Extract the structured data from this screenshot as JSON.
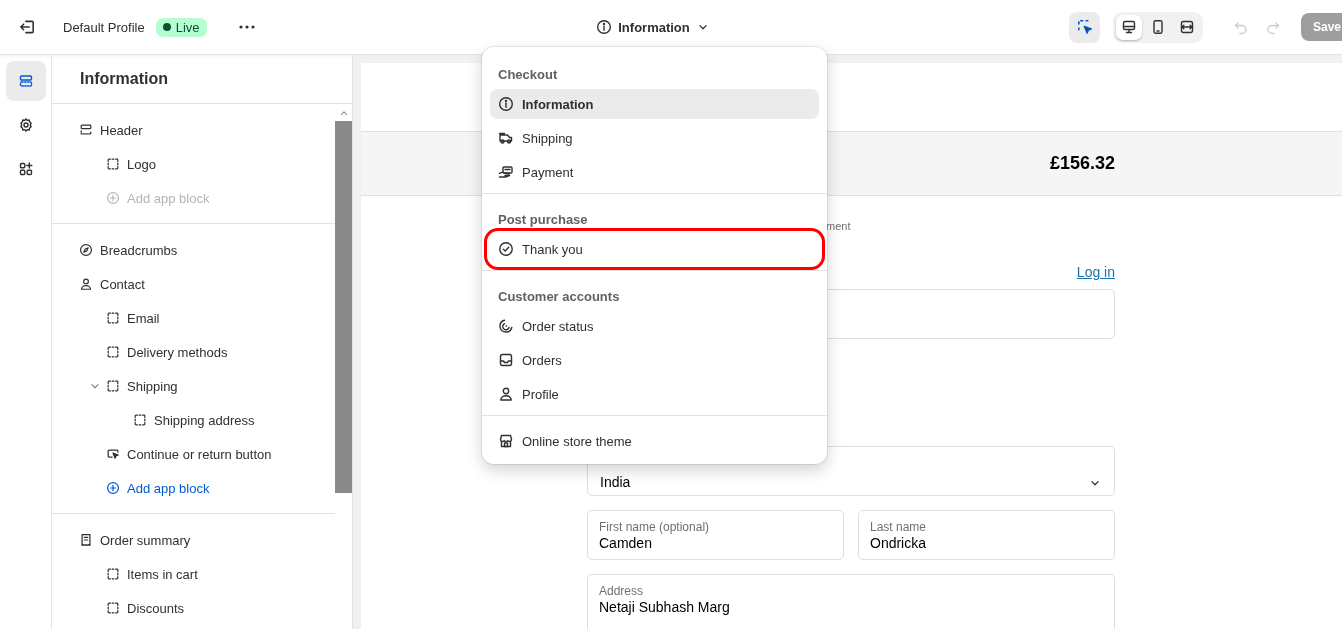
{
  "topbar": {
    "title": "Default Profile",
    "status": {
      "label": "Live",
      "live": true
    },
    "page_picker": {
      "label": "Information"
    },
    "undo_disabled": true,
    "redo_disabled": true,
    "save_button": {
      "label": "Save",
      "disabled": true
    }
  },
  "inspector_button": {
    "selected": true
  },
  "device_buttons": [
    {
      "selected": true
    },
    {
      "selected": false
    },
    {
      "selected": false
    }
  ],
  "rail": [
    {
      "selected": true
    },
    {
      "selected": false
    },
    {
      "selected": false
    }
  ],
  "sidebar": {
    "title": "Information",
    "sections": [
      {
        "items": [
          {
            "label": "Header",
            "children": [
              {
                "kind": "block",
                "label": "Logo"
              },
              {
                "kind": "add",
                "label": "Add app block",
                "disabled": true
              }
            ]
          }
        ]
      },
      {
        "items": [
          {
            "label": "Breadcrumbs"
          },
          {
            "label": "Contact",
            "children": [
              {
                "kind": "block",
                "label": "Email"
              },
              {
                "kind": "block",
                "label": "Delivery methods"
              },
              {
                "kind": "block",
                "label": "Shipping",
                "expanded": true,
                "children": [
                  {
                    "kind": "block",
                    "label": "Shipping address"
                  }
                ]
              },
              {
                "kind": "button",
                "label": "Continue or return button"
              },
              {
                "kind": "add",
                "label": "Add app block",
                "disabled": false
              }
            ]
          }
        ]
      },
      {
        "items": [
          {
            "label": "Order summary",
            "children": [
              {
                "kind": "block",
                "label": "Items in cart"
              },
              {
                "kind": "block",
                "label": "Discounts"
              }
            ]
          }
        ]
      }
    ]
  },
  "dropdown": {
    "groups": [
      {
        "heading": "Checkout",
        "items": [
          {
            "label": "Information",
            "selected": true,
            "highlighted": false
          },
          {
            "label": "Shipping",
            "selected": false,
            "highlighted": false
          },
          {
            "label": "Payment",
            "selected": false,
            "highlighted": false
          }
        ]
      },
      {
        "heading": "Post purchase",
        "items": [
          {
            "label": "Thank you",
            "selected": false,
            "highlighted": true
          }
        ]
      },
      {
        "heading": "Customer accounts",
        "items": [
          {
            "label": "Order status",
            "selected": false,
            "highlighted": false
          },
          {
            "label": "Orders",
            "selected": false,
            "highlighted": false
          },
          {
            "label": "Profile",
            "selected": false,
            "highlighted": false
          }
        ]
      },
      {
        "items": [
          {
            "label": "Online store theme",
            "selected": false,
            "highlighted": false
          }
        ]
      }
    ]
  },
  "preview": {
    "total": "£156.32",
    "breadcrumb_fragment": "ment",
    "login_link": "Log in",
    "country_field": {
      "value": "India"
    },
    "name_fields": [
      {
        "label": "First name (optional)",
        "value": "Camden"
      },
      {
        "label": "Last name",
        "value": "Ondricka"
      }
    ],
    "address_field": {
      "label": "Address",
      "value": "Netaji Subhash Marg"
    }
  }
}
